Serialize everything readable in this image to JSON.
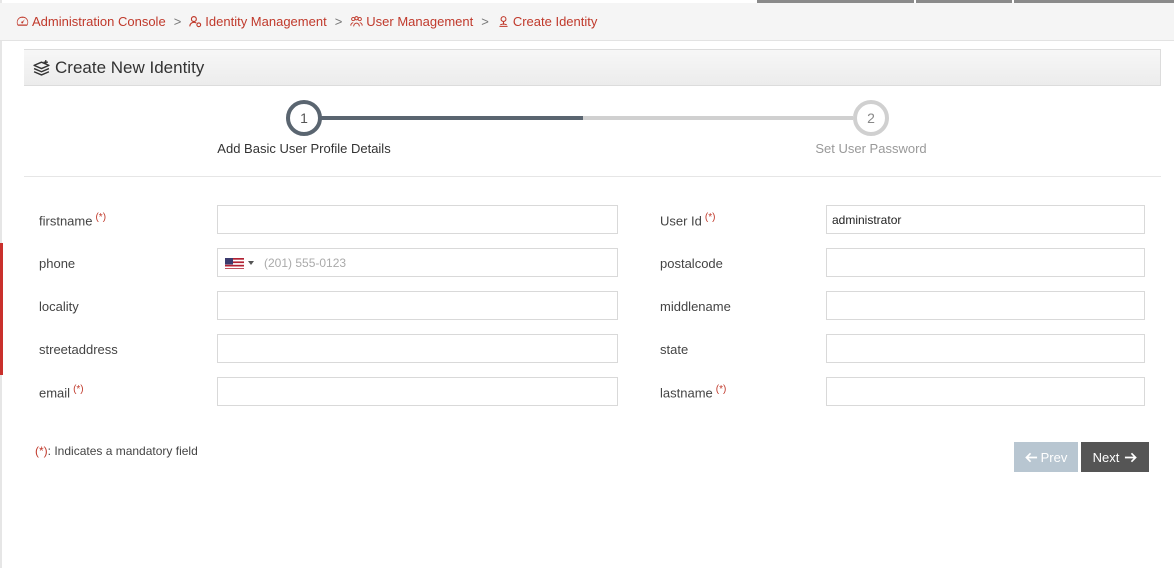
{
  "breadcrumb": {
    "items": [
      {
        "label": "Administration Console",
        "icon": "dashboard-icon"
      },
      {
        "label": "Identity Management",
        "icon": "user-gear-icon"
      },
      {
        "label": "User Management",
        "icon": "users-icon"
      },
      {
        "label": "Create Identity",
        "icon": "user-pin-icon"
      }
    ],
    "separator": ">"
  },
  "panel": {
    "title": "Create New Identity",
    "icon": "layers-add-icon"
  },
  "stepper": {
    "steps": [
      {
        "number": "1",
        "label": "Add Basic User Profile Details",
        "state": "active"
      },
      {
        "number": "2",
        "label": "Set User Password",
        "state": "pending"
      }
    ],
    "progress": 0.5
  },
  "form": {
    "required_mark": "(*)",
    "left_fields": [
      {
        "label": "firstname",
        "required": true,
        "value": ""
      },
      {
        "label": "phone",
        "required": false,
        "value": "",
        "placeholder": "(201) 555-0123",
        "country": "US"
      },
      {
        "label": "locality",
        "required": false,
        "value": ""
      },
      {
        "label": "streetaddress",
        "required": false,
        "value": ""
      },
      {
        "label": "email",
        "required": true,
        "value": ""
      }
    ],
    "right_fields": [
      {
        "label": "User Id",
        "required": true,
        "value": "administrator"
      },
      {
        "label": "postalcode",
        "required": false,
        "value": ""
      },
      {
        "label": "middlename",
        "required": false,
        "value": ""
      },
      {
        "label": "state",
        "required": false,
        "value": ""
      },
      {
        "label": "lastname",
        "required": true,
        "value": ""
      }
    ]
  },
  "footer": {
    "mandatory_mark": "(*)",
    "mandatory_text": ": Indicates a mandatory field",
    "prev_label": "Prev",
    "next_label": "Next"
  },
  "colors": {
    "accent": "#c0392b",
    "step_active": "#5a6570",
    "step_pending": "#d0d0d0",
    "prev_button": "#b8c6d1",
    "next_button": "#555555"
  }
}
